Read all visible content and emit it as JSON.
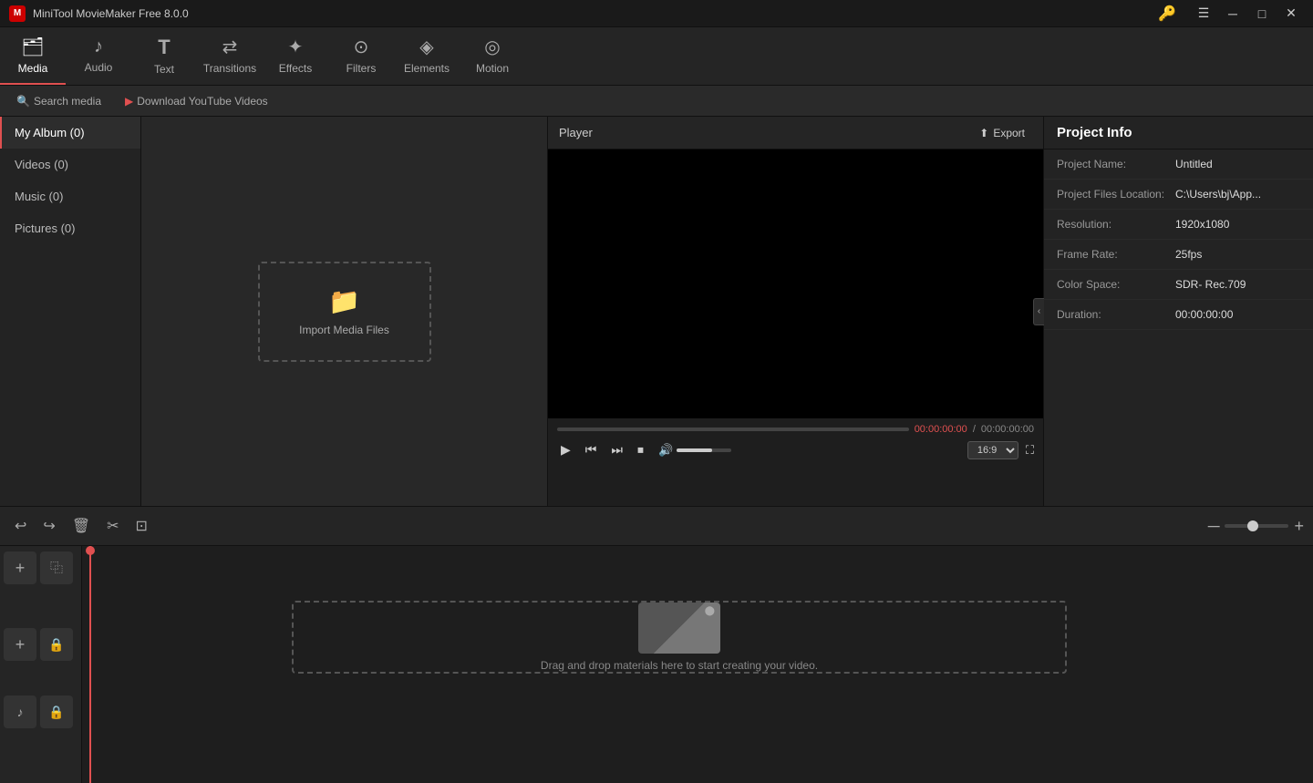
{
  "app": {
    "title": "MiniTool MovieMaker Free 8.0.0",
    "logo": "M"
  },
  "titlebar": {
    "menu_icon": "☰",
    "minimize": "─",
    "maximize": "□",
    "close": "✕",
    "key_icon": "🔑"
  },
  "toolbar": {
    "items": [
      {
        "id": "media",
        "label": "Media",
        "icon": "🗂",
        "active": true
      },
      {
        "id": "audio",
        "label": "Audio",
        "icon": "♪"
      },
      {
        "id": "text",
        "label": "Text",
        "icon": "T"
      },
      {
        "id": "transitions",
        "label": "Transitions",
        "icon": "↔"
      },
      {
        "id": "effects",
        "label": "Effects",
        "icon": "✦"
      },
      {
        "id": "filters",
        "label": "Filters",
        "icon": "⊙"
      },
      {
        "id": "elements",
        "label": "Elements",
        "icon": "◈"
      },
      {
        "id": "motion",
        "label": "Motion",
        "icon": "◎"
      }
    ]
  },
  "subtoolbar": {
    "tabs": [
      {
        "id": "search",
        "label": "Search media",
        "icon": "🔍"
      },
      {
        "id": "youtube",
        "label": "Download YouTube Videos",
        "icon": "▶"
      }
    ]
  },
  "sidebar": {
    "items": [
      {
        "id": "myalbum",
        "label": "My Album (0)",
        "active": true
      },
      {
        "id": "videos",
        "label": "Videos (0)"
      },
      {
        "id": "music",
        "label": "Music (0)"
      },
      {
        "id": "pictures",
        "label": "Pictures (0)"
      }
    ]
  },
  "media_panel": {
    "import_label": "Import Media Files",
    "import_icon": "📁"
  },
  "player": {
    "title": "Player",
    "export_label": "Export",
    "export_icon": "⬆",
    "current_time": "00:00:00:00",
    "total_time": "00:00:00:00",
    "aspect_ratio": "16:9"
  },
  "project_info": {
    "title": "Project Info",
    "fields": [
      {
        "label": "Project Name:",
        "value": "Untitled"
      },
      {
        "label": "Project Files Location:",
        "value": "C:\\Users\\bj\\App..."
      },
      {
        "label": "Resolution:",
        "value": "1920x1080"
      },
      {
        "label": "Frame Rate:",
        "value": "25fps"
      },
      {
        "label": "Color Space:",
        "value": "SDR- Rec.709"
      },
      {
        "label": "Duration:",
        "value": "00:00:00:00"
      }
    ]
  },
  "timeline": {
    "undo_icon": "↩",
    "redo_icon": "↪",
    "delete_icon": "🗑",
    "cut_icon": "✂",
    "crop_icon": "⊡",
    "zoom_minus": "─",
    "zoom_plus": "+",
    "drop_text": "Drag and drop materials here to start creating your video.",
    "track_icons": [
      {
        "id": "add-track",
        "icon": "+"
      },
      {
        "id": "copy-track",
        "icon": "⿻"
      },
      {
        "id": "video-track-add",
        "icon": "+"
      },
      {
        "id": "video-track-lock",
        "icon": "🔒"
      },
      {
        "id": "audio-track-add",
        "icon": "♪"
      },
      {
        "id": "audio-track-lock",
        "icon": "🔒"
      }
    ]
  }
}
